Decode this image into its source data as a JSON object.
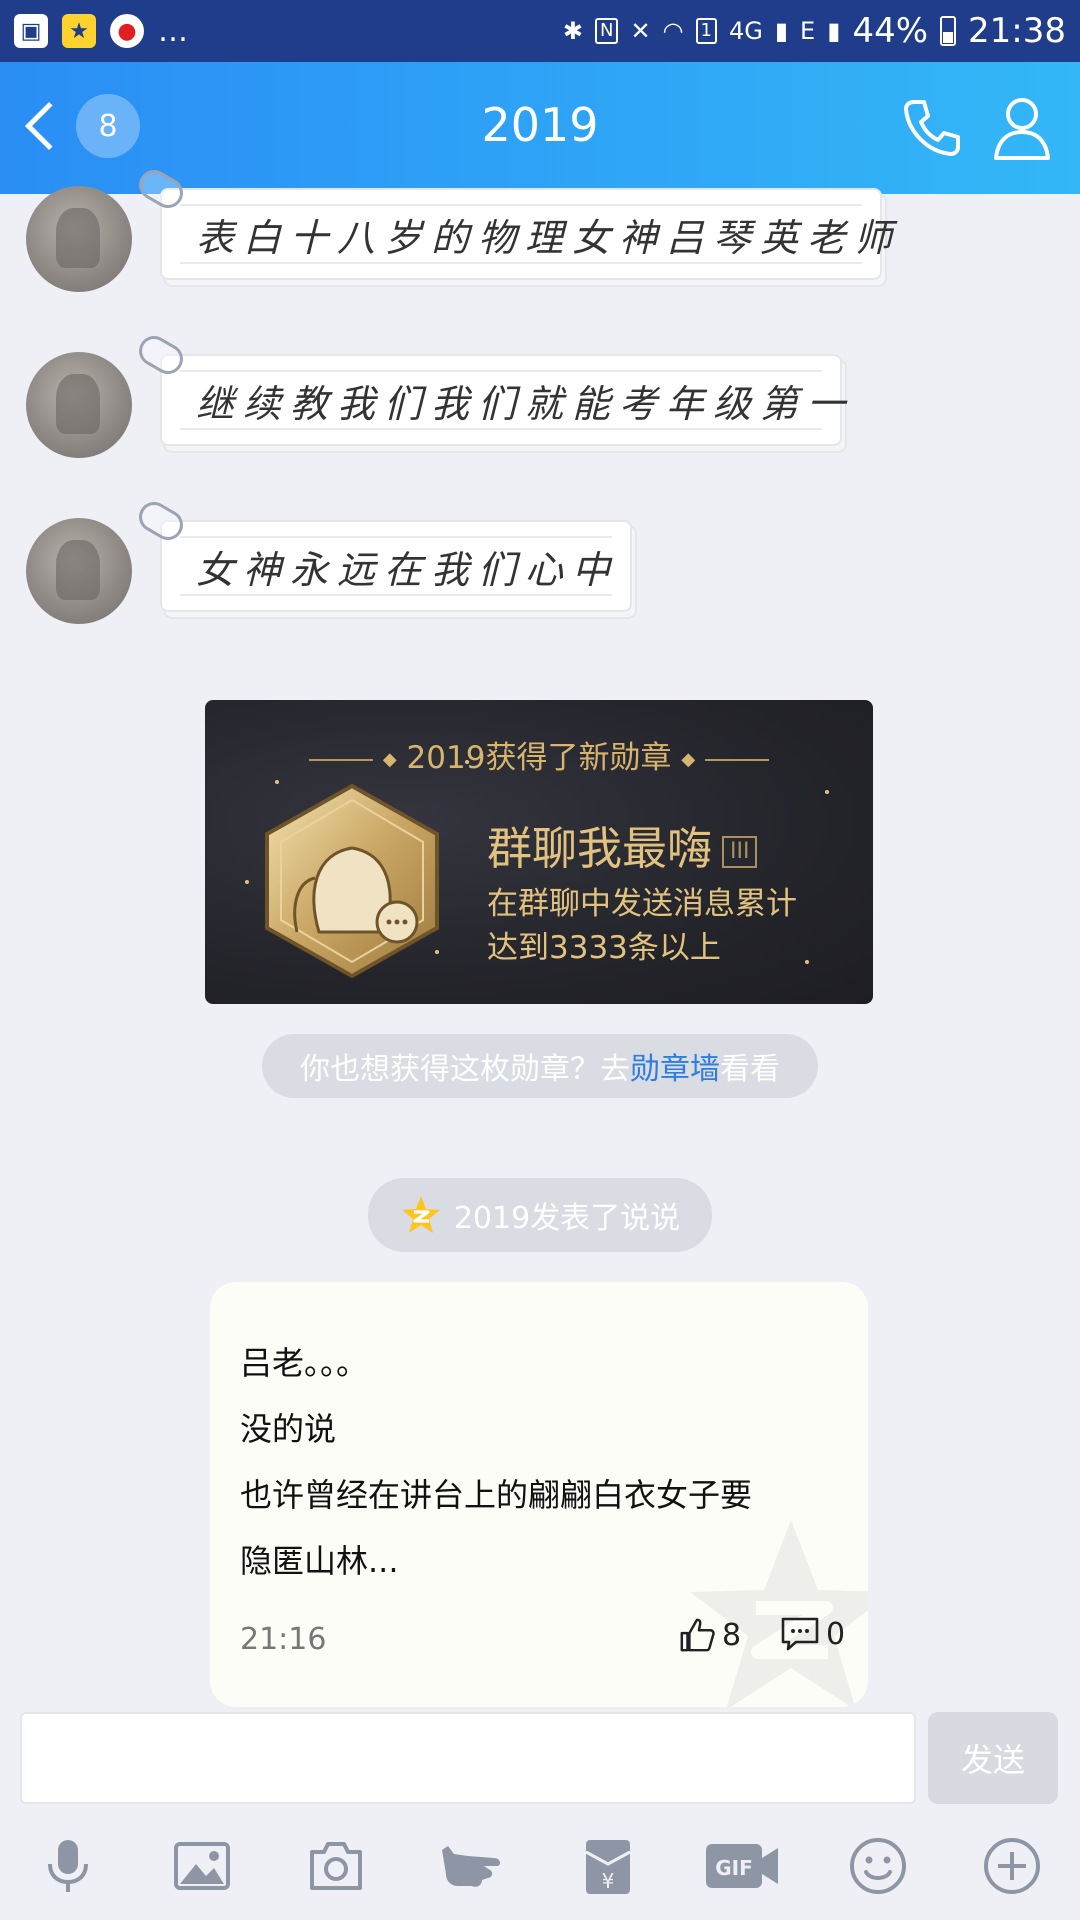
{
  "status_bar": {
    "notif_icons": [
      "image-icon",
      "qzone-star-icon",
      "record-icon"
    ],
    "more": "…",
    "network": "4G",
    "sim": "1",
    "network2": "E",
    "battery": "44%",
    "time": "21:38"
  },
  "header": {
    "back_count": "8",
    "title": "2019"
  },
  "messages": [
    {
      "text": "表白十八岁的物理女神吕琴英老师"
    },
    {
      "text": "继续教我们我们就能考年级第一"
    },
    {
      "text": "女神永远在我们心中"
    }
  ],
  "medal": {
    "heading": "2019获得了新勋章",
    "name": "群聊我最嗨",
    "level": "III",
    "desc_line1": "在群聊中发送消息累计",
    "desc_line2": "达到3333条以上"
  },
  "medal_hint": {
    "prefix": "你也想获得这枚勋章？去",
    "link": "勋章墙",
    "suffix": "看看"
  },
  "qzone_pill": {
    "text": "2019发表了说说"
  },
  "post": {
    "lines": [
      "吕老。。。",
      "没的说",
      "也许曾经在讲台上的翩翩白衣女子要",
      "隐匿山林..."
    ],
    "time": "21:16",
    "likes": "8",
    "comments": "0"
  },
  "composer": {
    "placeholder": "",
    "send_label": "发送"
  },
  "colors": {
    "header_start": "#2a8ef5",
    "header_end": "#33b7f7",
    "medal_gold": "#e2c27f",
    "link_blue": "#2f7ddc"
  }
}
